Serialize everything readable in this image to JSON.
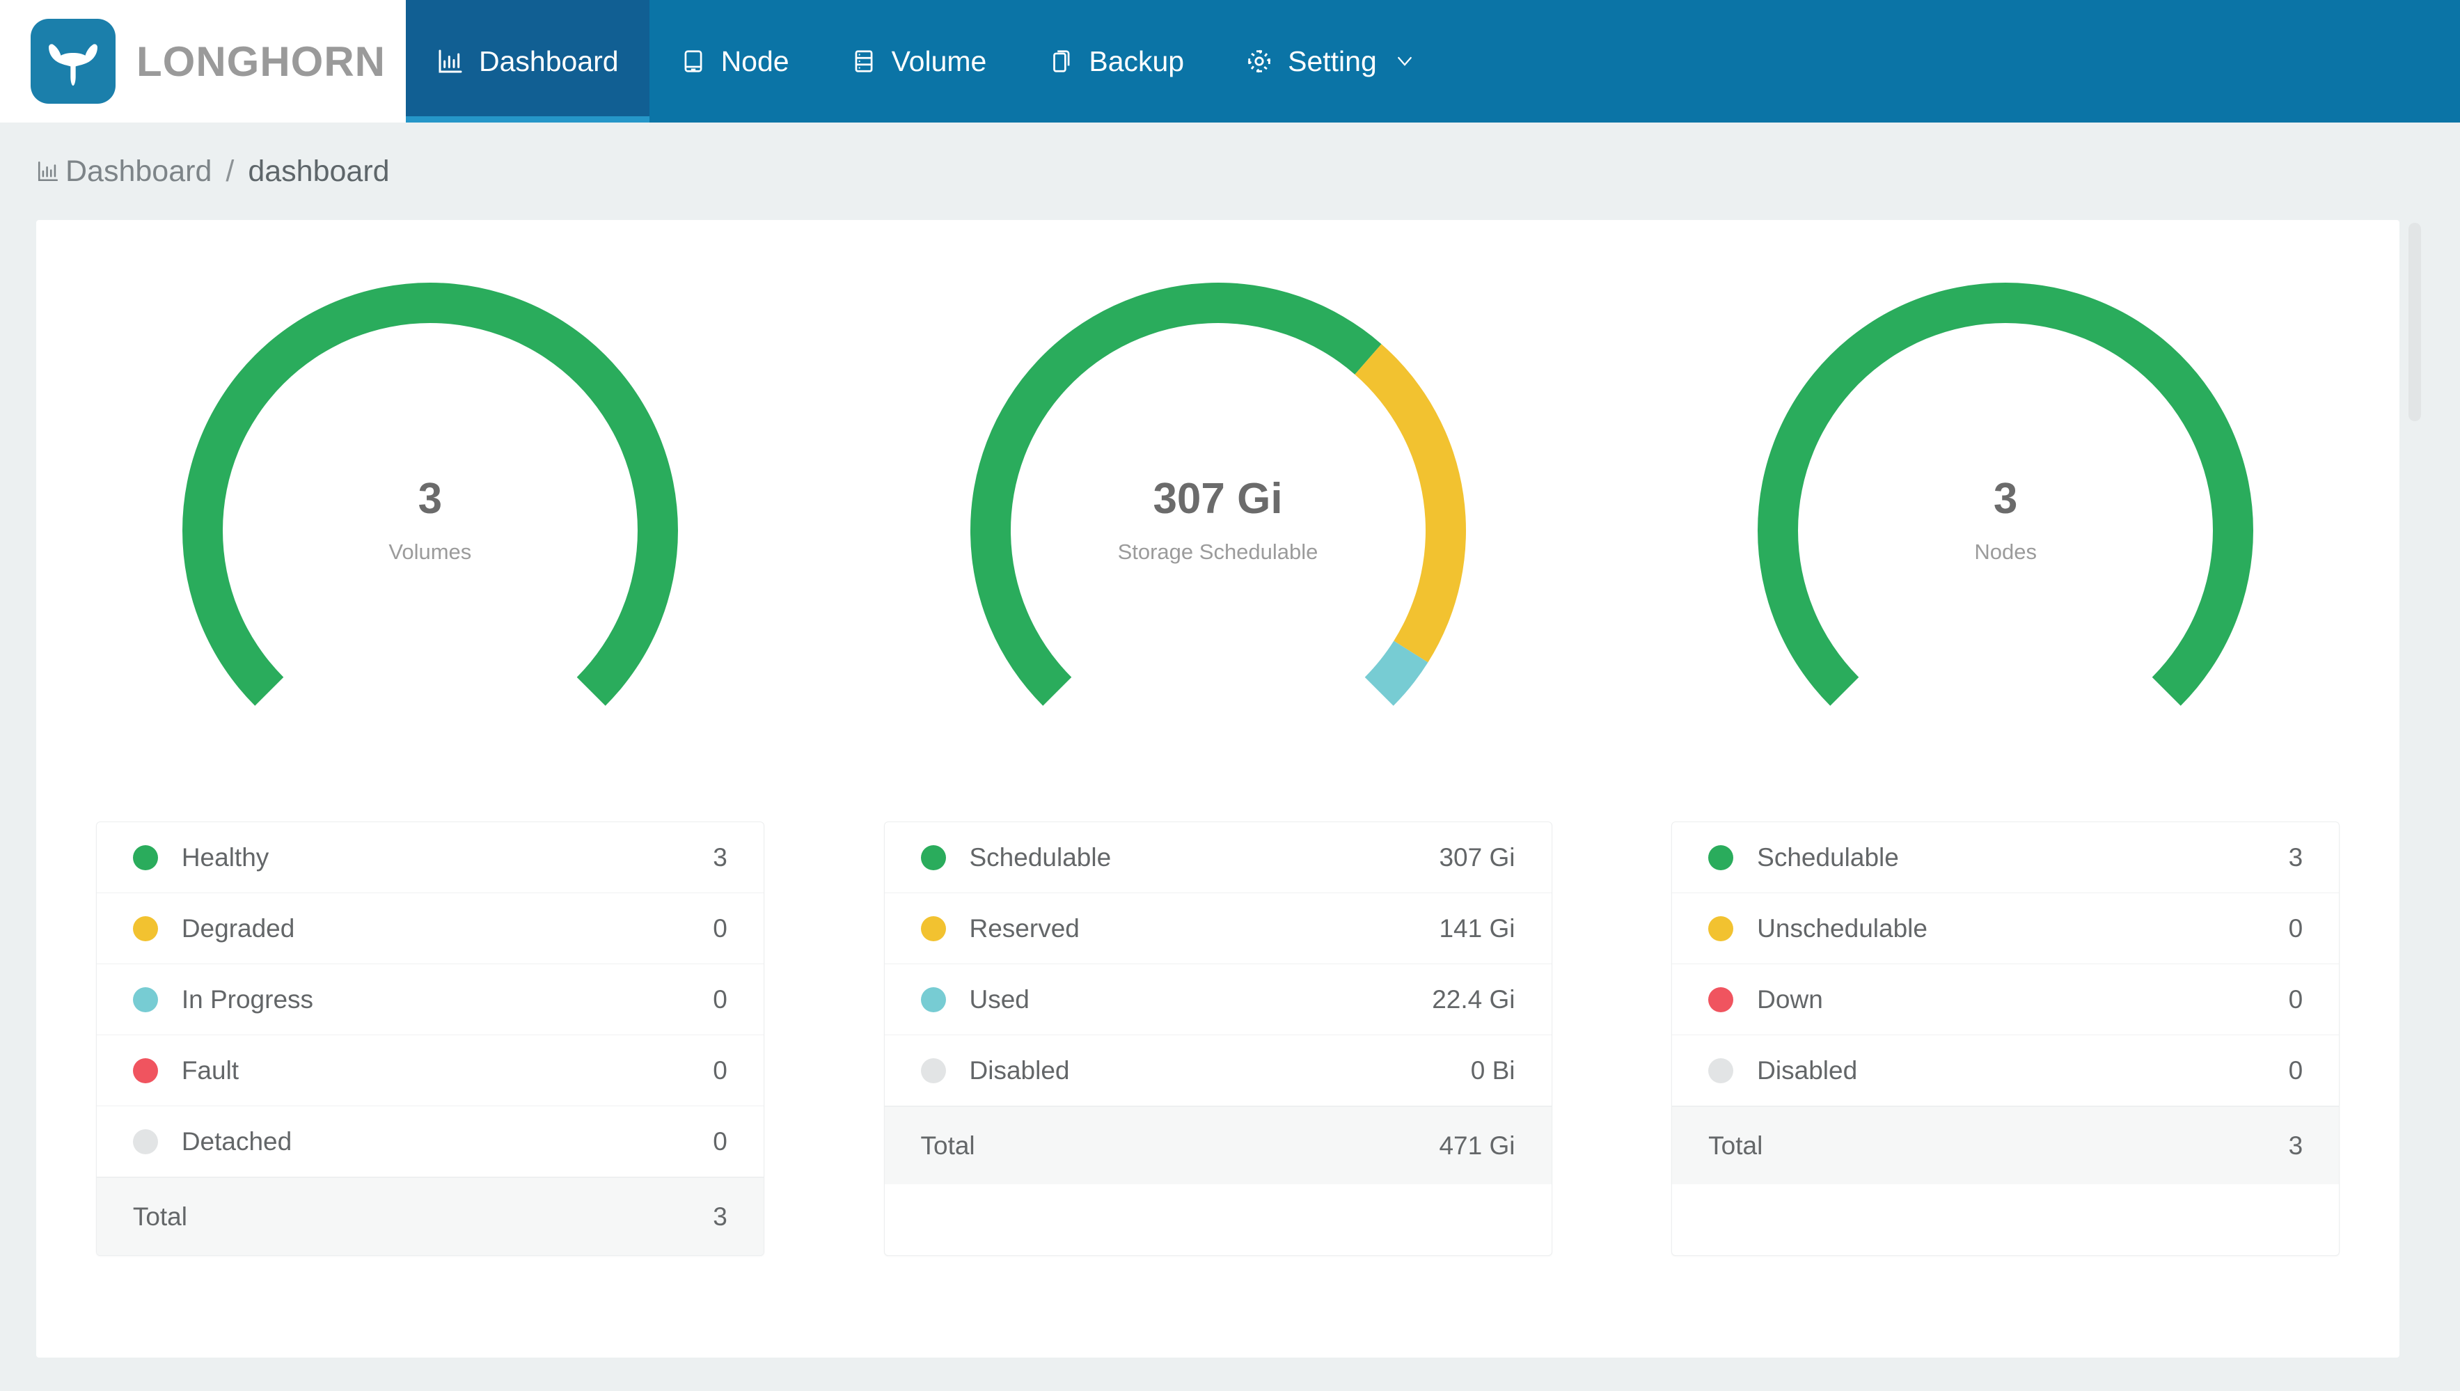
{
  "brand": {
    "name": "LONGHORN",
    "logo_icon": "longhorn-bull-icon",
    "logo_color": "#1b7fab"
  },
  "nav": {
    "background_color": "#0b74a6",
    "active_background_color": "#115f93",
    "items": [
      {
        "label": "Dashboard",
        "icon": "bar-chart-icon",
        "active": true
      },
      {
        "label": "Node",
        "icon": "desktop-icon",
        "active": false
      },
      {
        "label": "Volume",
        "icon": "database-icon",
        "active": false
      },
      {
        "label": "Backup",
        "icon": "copy-icon",
        "active": false
      },
      {
        "label": "Setting",
        "icon": "gear-icon",
        "active": false,
        "has_chevron": true,
        "chevron_icon": "chevron-down-icon"
      }
    ]
  },
  "breadcrumb": {
    "icon": "bar-chart-icon",
    "root": "Dashboard",
    "separator": "/",
    "current": "dashboard"
  },
  "colors": {
    "green": "#2aac5c",
    "yellow": "#f2c230",
    "cyan": "#77ccd3",
    "red": "#f0545f",
    "gray": "#e2e4e5",
    "page_background": "#ecf0f1",
    "card_background": "#ffffff"
  },
  "chart_data": [
    {
      "type": "pie",
      "title": "Volumes",
      "center_value": "3",
      "center_label": "Volumes",
      "gauge_id": "volumes-gauge",
      "categories": [
        "Healthy",
        "Degraded",
        "In Progress",
        "Fault",
        "Detached"
      ],
      "values": [
        3,
        0,
        0,
        0,
        0
      ],
      "colors": [
        "#2aac5c",
        "#f2c230",
        "#77ccd3",
        "#f0545f",
        "#e2e4e5"
      ],
      "total_label": "Total",
      "total_value": "3",
      "legend": [
        {
          "label": "Healthy",
          "value": "3",
          "color": "#2aac5c"
        },
        {
          "label": "Degraded",
          "value": "0",
          "color": "#f2c230"
        },
        {
          "label": "In Progress",
          "value": "0",
          "color": "#77ccd3"
        },
        {
          "label": "Fault",
          "value": "0",
          "color": "#f0545f"
        },
        {
          "label": "Detached",
          "value": "0",
          "color": "#e2e4e5"
        }
      ]
    },
    {
      "type": "pie",
      "title": "Storage Schedulable",
      "center_value": "307 Gi",
      "center_label": "Storage Schedulable",
      "gauge_id": "storage-gauge",
      "categories": [
        "Schedulable",
        "Reserved",
        "Used",
        "Disabled"
      ],
      "values": [
        307,
        141,
        22.4,
        0
      ],
      "unit": "Gi",
      "colors": [
        "#2aac5c",
        "#f2c230",
        "#77ccd3",
        "#e2e4e5"
      ],
      "total_label": "Total",
      "total_value": "471 Gi",
      "legend": [
        {
          "label": "Schedulable",
          "value": "307 Gi",
          "color": "#2aac5c"
        },
        {
          "label": "Reserved",
          "value": "141 Gi",
          "color": "#f2c230"
        },
        {
          "label": "Used",
          "value": "22.4 Gi",
          "color": "#77ccd3"
        },
        {
          "label": "Disabled",
          "value": "0 Bi",
          "color": "#e2e4e5"
        }
      ]
    },
    {
      "type": "pie",
      "title": "Nodes",
      "center_value": "3",
      "center_label": "Nodes",
      "gauge_id": "nodes-gauge",
      "categories": [
        "Schedulable",
        "Unschedulable",
        "Down",
        "Disabled"
      ],
      "values": [
        3,
        0,
        0,
        0
      ],
      "colors": [
        "#2aac5c",
        "#f2c230",
        "#f0545f",
        "#e2e4e5"
      ],
      "total_label": "Total",
      "total_value": "3",
      "legend": [
        {
          "label": "Schedulable",
          "value": "3",
          "color": "#2aac5c"
        },
        {
          "label": "Unschedulable",
          "value": "0",
          "color": "#f2c230"
        },
        {
          "label": "Down",
          "value": "0",
          "color": "#f0545f"
        },
        {
          "label": "Disabled",
          "value": "0",
          "color": "#e2e4e5"
        }
      ]
    }
  ]
}
